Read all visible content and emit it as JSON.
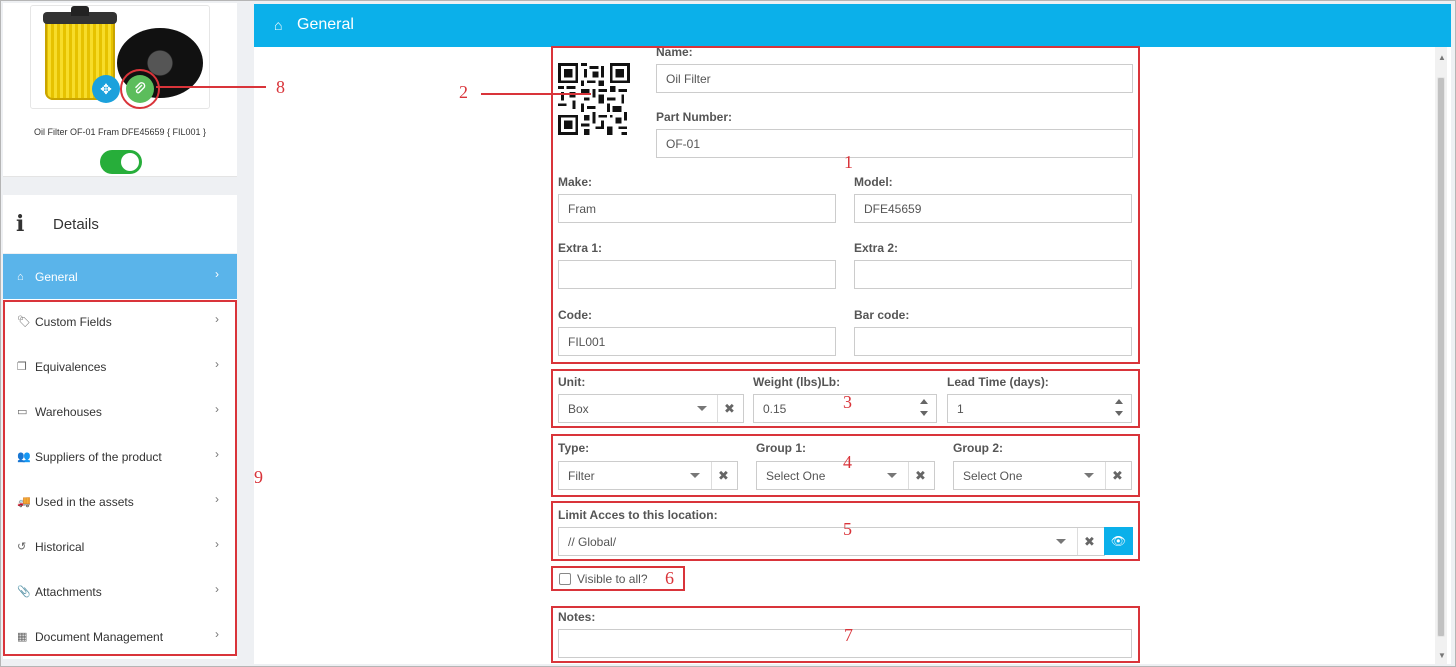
{
  "product": {
    "caption": "Oil Filter OF-01 Fram DFE45659 { FIL001 }",
    "active": true
  },
  "details": {
    "title": "Details"
  },
  "nav": {
    "items": [
      {
        "label": "General",
        "icon": "home-icon",
        "active": true
      },
      {
        "label": "Custom Fields",
        "icon": "tags-icon"
      },
      {
        "label": "Equivalences",
        "icon": "copy-icon"
      },
      {
        "label": "Warehouses",
        "icon": "inbox-icon"
      },
      {
        "label": "Suppliers of the product",
        "icon": "users-icon"
      },
      {
        "label": "Used in the assets",
        "icon": "truck-icon"
      },
      {
        "label": "Historical",
        "icon": "history-icon"
      },
      {
        "label": "Attachments",
        "icon": "paperclip-icon"
      },
      {
        "label": "Document Management",
        "icon": "calendar-icon"
      }
    ]
  },
  "header": {
    "title": "General"
  },
  "form": {
    "name_label": "Name:",
    "name_value": "Oil Filter",
    "part_label": "Part Number:",
    "part_value": "OF-01",
    "make_label": "Make:",
    "make_value": "Fram",
    "model_label": "Model:",
    "model_value": "DFE45659",
    "extra1_label": "Extra 1:",
    "extra1_value": "",
    "extra2_label": "Extra 2:",
    "extra2_value": "",
    "code_label": "Code:",
    "code_value": "FIL001",
    "barcode_label": "Bar code:",
    "barcode_value": "",
    "unit_label": "Unit:",
    "unit_value": "Box",
    "weight_label": "Weight (lbs)Lb:",
    "weight_value": "0.15",
    "lead_label": "Lead Time (days):",
    "lead_value": "1",
    "type_label": "Type:",
    "type_value": "Filter",
    "group1_label": "Group 1:",
    "group1_value": "Select One",
    "group2_label": "Group 2:",
    "group2_value": "Select One",
    "limit_label": "Limit Acces to this location:",
    "limit_value": "// Global/",
    "visible_label": "Visible to all?",
    "visible_checked": false,
    "notes_label": "Notes:",
    "notes_value": ""
  },
  "annotations": {
    "n1": "1",
    "n2": "2",
    "n3": "3",
    "n4": "4",
    "n5": "5",
    "n6": "6",
    "n7": "7",
    "n8": "8",
    "n9": "9"
  },
  "colors": {
    "accent": "#0bb0ea",
    "nav_active": "#5ab4ea",
    "annotation": "#d9343a",
    "toggle_on": "#27ae3a"
  }
}
